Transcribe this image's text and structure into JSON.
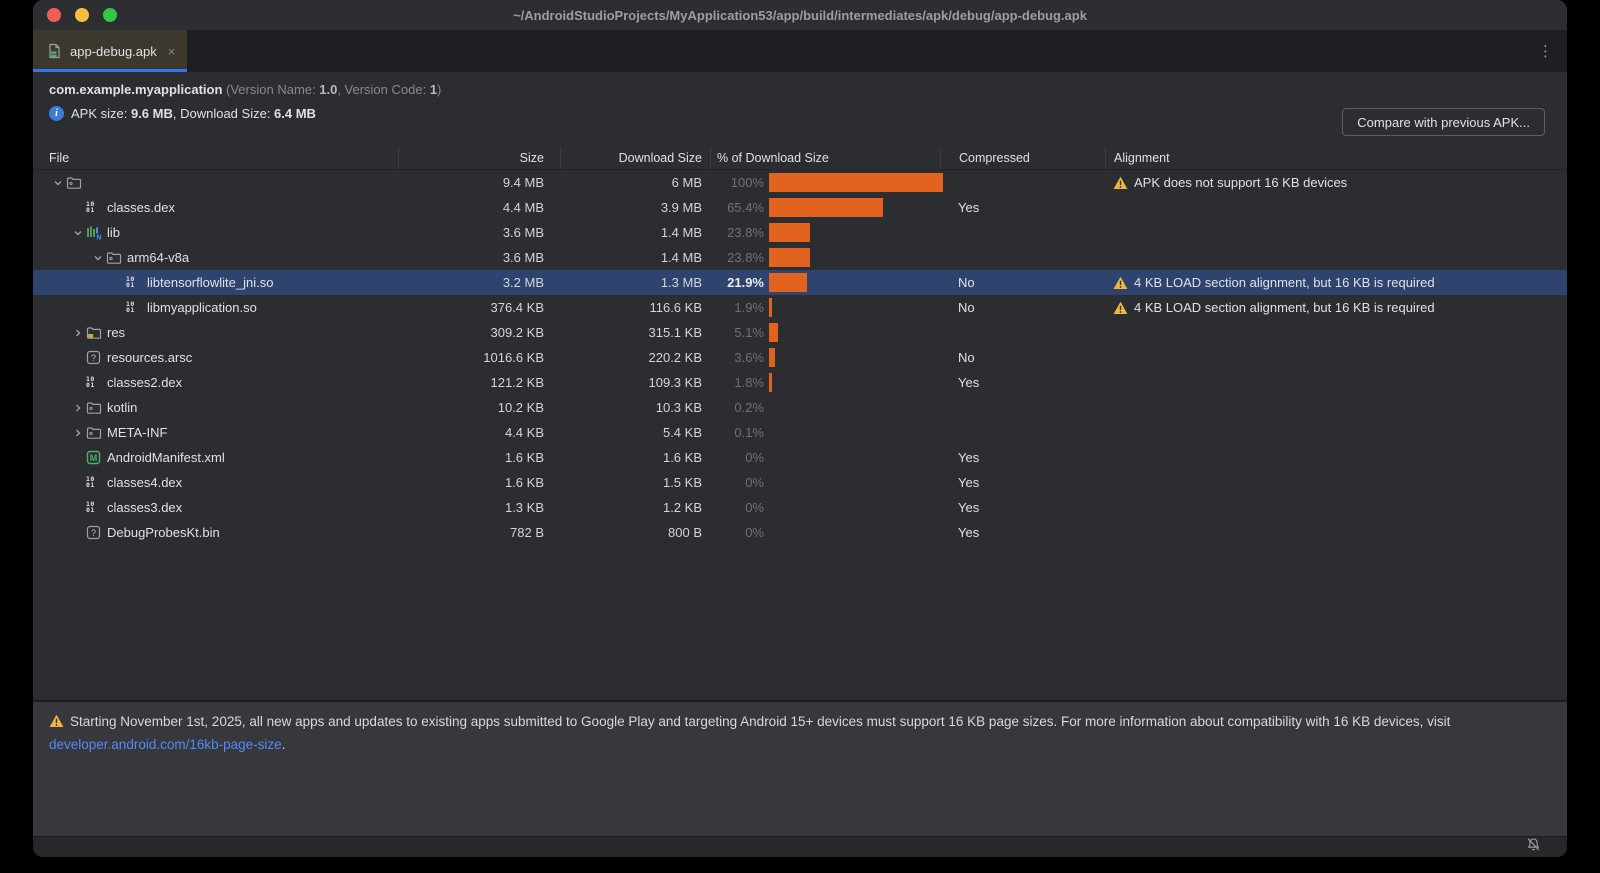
{
  "window": {
    "title": "~/AndroidStudioProjects/MyApplication53/app/build/intermediates/apk/debug/app-debug.apk"
  },
  "tab": {
    "label": "app-debug.apk",
    "close": "×",
    "kebab": "⋮"
  },
  "header": {
    "package": "com.example.myapplication",
    "version_prefix": " (Version Name: ",
    "version_name": "1.0",
    "version_mid": ", Version Code: ",
    "version_code": "1",
    "version_suffix": ")"
  },
  "apk_line": {
    "label1": "APK size: ",
    "size": "9.6 MB",
    "label2": ", Download Size: ",
    "download": "6.4 MB"
  },
  "toolbar": {
    "compare_label": "Compare with previous APK..."
  },
  "columns": {
    "file": "File",
    "size": "Size",
    "download": "Download Size",
    "pct": "% of Download Size",
    "compressed": "Compressed",
    "alignment": "Alignment"
  },
  "accent_colors": {
    "bar": "#e2621f",
    "selection": "#2e436e",
    "link": "#548af7",
    "warning": "#f0b73f",
    "tab_underline": "#3574f0"
  },
  "rows": [
    {
      "indent": 0,
      "chevron": "down",
      "icon": "folder-icon",
      "label": "",
      "size": "9.4 MB",
      "download": "6 MB",
      "pct": "100%",
      "pct_value": 100,
      "compressed": "",
      "alignment": "APK does not support 16 KB devices",
      "selected": false
    },
    {
      "indent": 1,
      "chevron": null,
      "icon": "dex-file-icon",
      "label": "classes.dex",
      "size": "4.4 MB",
      "download": "3.9 MB",
      "pct": "65.4%",
      "pct_value": 65.4,
      "compressed": "Yes",
      "alignment": null,
      "selected": false
    },
    {
      "indent": 1,
      "chevron": "down",
      "icon": "native-lib-icon",
      "label": "lib",
      "size": "3.6 MB",
      "download": "1.4 MB",
      "pct": "23.8%",
      "pct_value": 23.8,
      "compressed": "",
      "alignment": null,
      "selected": false
    },
    {
      "indent": 2,
      "chevron": "down",
      "icon": "folder-icon",
      "label": "arm64-v8a",
      "size": "3.6 MB",
      "download": "1.4 MB",
      "pct": "23.8%",
      "pct_value": 23.8,
      "compressed": "",
      "alignment": null,
      "selected": false
    },
    {
      "indent": 3,
      "chevron": null,
      "icon": "dex-file-icon",
      "label": "libtensorflowlite_jni.so",
      "size": "3.2 MB",
      "download": "1.3 MB",
      "pct": "21.9%",
      "pct_value": 21.9,
      "compressed": "No",
      "alignment": "4 KB LOAD section alignment, but 16 KB is required",
      "selected": true
    },
    {
      "indent": 3,
      "chevron": null,
      "icon": "dex-file-icon",
      "label": "libmyapplication.so",
      "size": "376.4 KB",
      "download": "116.6 KB",
      "pct": "1.9%",
      "pct_value": 1.9,
      "compressed": "No",
      "alignment": "4 KB LOAD section alignment, but 16 KB is required",
      "selected": false
    },
    {
      "indent": 1,
      "chevron": "right",
      "icon": "res-folder-icon",
      "label": "res",
      "size": "309.2 KB",
      "download": "315.1 KB",
      "pct": "5.1%",
      "pct_value": 5.1,
      "compressed": "",
      "alignment": null,
      "selected": false
    },
    {
      "indent": 1,
      "chevron": null,
      "icon": "unknown-file-icon",
      "label": "resources.arsc",
      "size": "1016.6 KB",
      "download": "220.2 KB",
      "pct": "3.6%",
      "pct_value": 3.6,
      "compressed": "No",
      "alignment": null,
      "selected": false
    },
    {
      "indent": 1,
      "chevron": null,
      "icon": "dex-file-icon",
      "label": "classes2.dex",
      "size": "121.2 KB",
      "download": "109.3 KB",
      "pct": "1.8%",
      "pct_value": 1.8,
      "compressed": "Yes",
      "alignment": null,
      "selected": false
    },
    {
      "indent": 1,
      "chevron": "right",
      "icon": "pkg-folder-icon",
      "label": "kotlin",
      "size": "10.2 KB",
      "download": "10.3 KB",
      "pct": "0.2%",
      "pct_value": 0.2,
      "compressed": "",
      "alignment": null,
      "selected": false
    },
    {
      "indent": 1,
      "chevron": "right",
      "icon": "pkg-folder-icon",
      "label": "META-INF",
      "size": "4.4 KB",
      "download": "5.4 KB",
      "pct": "0.1%",
      "pct_value": 0.1,
      "compressed": "",
      "alignment": null,
      "selected": false
    },
    {
      "indent": 1,
      "chevron": null,
      "icon": "manifest-file-icon",
      "label": "AndroidManifest.xml",
      "size": "1.6 KB",
      "download": "1.6 KB",
      "pct": "0%",
      "pct_value": 0,
      "compressed": "Yes",
      "alignment": null,
      "selected": false
    },
    {
      "indent": 1,
      "chevron": null,
      "icon": "dex-file-icon",
      "label": "classes4.dex",
      "size": "1.6 KB",
      "download": "1.5 KB",
      "pct": "0%",
      "pct_value": 0,
      "compressed": "Yes",
      "alignment": null,
      "selected": false
    },
    {
      "indent": 1,
      "chevron": null,
      "icon": "dex-file-icon",
      "label": "classes3.dex",
      "size": "1.3 KB",
      "download": "1.2 KB",
      "pct": "0%",
      "pct_value": 0,
      "compressed": "Yes",
      "alignment": null,
      "selected": false
    },
    {
      "indent": 1,
      "chevron": null,
      "icon": "unknown-file-icon",
      "label": "DebugProbesKt.bin",
      "size": "782 B",
      "download": "800 B",
      "pct": "0%",
      "pct_value": 0,
      "compressed": "Yes",
      "alignment": null,
      "selected": false
    }
  ],
  "banner": {
    "text_before": "Starting November 1st, 2025, all new apps and updates to existing apps submitted to Google Play and targeting Android 15+ devices must support 16 KB page sizes. For more information about compatibility with 16 KB devices, visit ",
    "link": "developer.android.com/16kb-page-size",
    "text_after": "."
  }
}
